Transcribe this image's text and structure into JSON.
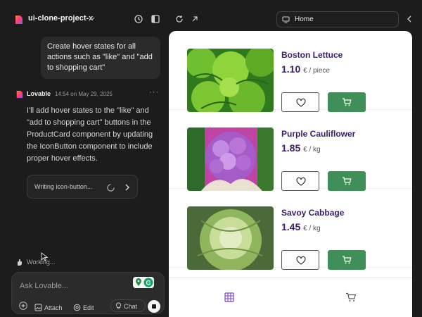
{
  "colors": {
    "bg": "#1c1c1c",
    "accent_purple": "#3a1d6b",
    "cart_green": "#3f8f58",
    "nav_active": "#7b3fd0"
  },
  "chat": {
    "project_name": "ui-clone-project-x",
    "user_message": "Create hover states for all actions such as \"like\" and \"add to shopping cart\"",
    "assistant": {
      "name": "Lovable",
      "timestamp": "14:54 on May 29, 2025",
      "message": "I'll add hover states to the \"like\" and \"add to shopping cart\" buttons in the ProductCard component by updating the IconButton component to include proper hover effects.",
      "tool_status": "Writing icon-button..."
    },
    "working_label": "Working...",
    "composer": {
      "placeholder": "Ask Lovable...",
      "attach_label": "Attach",
      "edit_label": "Edit",
      "chat_label": "Chat"
    }
  },
  "preview": {
    "url_label": "Home",
    "products": [
      {
        "name": "Boston Lettuce",
        "price": "1.10",
        "unit": "€ / piece"
      },
      {
        "name": "Purple Cauliflower",
        "price": "1.85",
        "unit": "€ / kg"
      },
      {
        "name": "Savoy Cabbage",
        "price": "1.45",
        "unit": "€ / kg"
      }
    ]
  }
}
